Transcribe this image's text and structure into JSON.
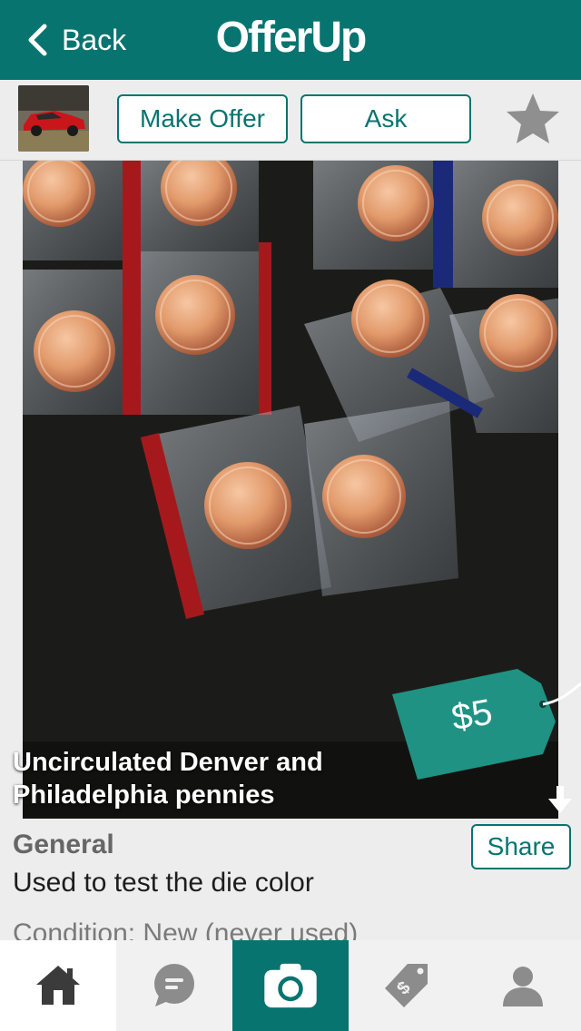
{
  "header": {
    "back_label": "Back",
    "brand": "OfferUp"
  },
  "actions": {
    "make_offer": "Make Offer",
    "ask": "Ask"
  },
  "listing": {
    "title_line1": "Uncirculated Denver and",
    "title_line2": "Philadelphia pennies",
    "price": "$5",
    "category": "General",
    "description": "Used to test the die color",
    "condition": "Condition: New (never used)",
    "share_label": "Share"
  },
  "nav": {
    "items": [
      "home-icon",
      "messages-icon",
      "camera-icon",
      "selling-tag-icon",
      "profile-icon"
    ]
  },
  "colors": {
    "brand_teal": "#087470",
    "price_tag": "#1f9283"
  }
}
